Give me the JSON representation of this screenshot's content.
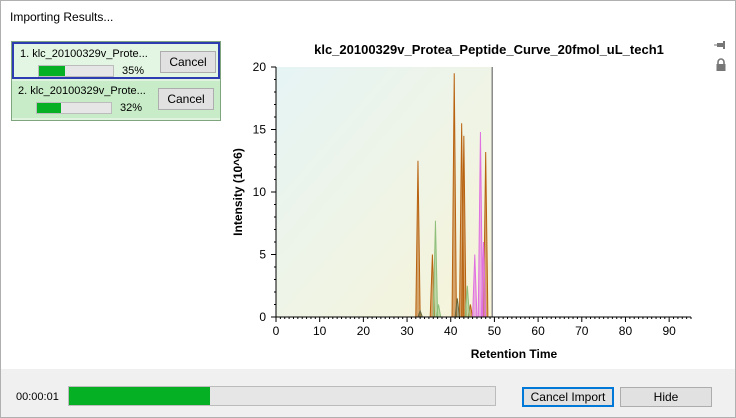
{
  "window": {
    "title": "Importing Results..."
  },
  "jobs": [
    {
      "label": "1. klc_20100329v_Prote...",
      "progress": 0.35,
      "percent": "35%",
      "button": "Cancel",
      "selected": true
    },
    {
      "label": "2. klc_20100329v_Prote...",
      "progress": 0.32,
      "percent": "32%",
      "button": "Cancel",
      "selected": false
    }
  ],
  "side_icons": [
    "pin-icon",
    "lock-icon"
  ],
  "chart_data": {
    "type": "line",
    "title": "klc_20100329v_Protea_Peptide_Curve_20fmol_uL_tech1",
    "xlabel": "Retention Time",
    "ylabel": "Intensity (10^6)",
    "xlim": [
      0,
      95
    ],
    "ylim": [
      0,
      20
    ],
    "xticks": [
      "0",
      "10",
      "20",
      "30",
      "40",
      "50",
      "60",
      "70",
      "80",
      "90"
    ],
    "yticks": [
      "0",
      "5",
      "10",
      "15",
      "20"
    ],
    "imported_up_to": 49.5,
    "series": [
      {
        "color": "#b8620f",
        "peaks": [
          [
            32.5,
            12.5
          ],
          [
            35.8,
            5.0
          ],
          [
            40.8,
            19.5
          ],
          [
            42.5,
            15.5
          ],
          [
            43.0,
            14.5
          ],
          [
            44.5,
            1.0
          ],
          [
            48.0,
            13.2
          ]
        ]
      },
      {
        "color": "#8fbf7a",
        "peaks": [
          [
            36.5,
            7.7
          ],
          [
            37.2,
            1.0
          ],
          [
            43.8,
            2.5
          ]
        ]
      },
      {
        "color": "#e070e0",
        "peaks": [
          [
            45.5,
            5.0
          ],
          [
            46.8,
            14.8
          ],
          [
            47.5,
            6.0
          ]
        ]
      },
      {
        "color": "#6a6a40",
        "peaks": [
          [
            33.0,
            0.5
          ],
          [
            41.5,
            1.5
          ]
        ]
      }
    ]
  },
  "footer": {
    "elapsed": "00:00:01",
    "progress": 0.33,
    "cancel_label": "Cancel Import",
    "hide_label": "Hide"
  }
}
